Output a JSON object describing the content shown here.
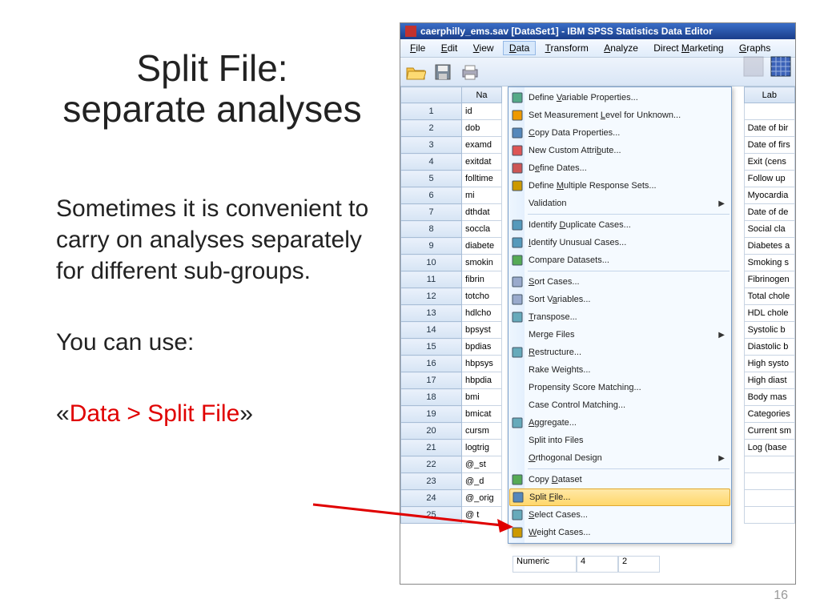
{
  "slide": {
    "title_line1": "Split File:",
    "title_line2": "separate analyses",
    "body1": "Sometimes it is convenient to carry on analyses separately for different sub-groups.",
    "body2_pre": "You can use:",
    "body3_open": "«",
    "body3_red": "Data > Split File",
    "body3_close": "»",
    "page_number": "16"
  },
  "spss": {
    "title": "caerphilly_ems.sav [DataSet1] - IBM SPSS Statistics Data Editor",
    "menubar": {
      "file": "File",
      "edit": "Edit",
      "view": "View",
      "data": "Data",
      "transform": "Transform",
      "analyze": "Analyze",
      "direct_marketing": "Direct Marketing",
      "graphs": "Graphs"
    },
    "grid": {
      "name_header": "Na",
      "label_header": "Lab",
      "rows": [
        {
          "n": "1",
          "name": "id",
          "label": ""
        },
        {
          "n": "2",
          "name": "dob",
          "label": "Date of bir"
        },
        {
          "n": "3",
          "name": "examd",
          "label": "Date of firs"
        },
        {
          "n": "4",
          "name": "exitdat",
          "label": "Exit (cens"
        },
        {
          "n": "5",
          "name": "folltime",
          "label": "Follow up"
        },
        {
          "n": "6",
          "name": "mi",
          "label": "Myocardia"
        },
        {
          "n": "7",
          "name": "dthdat",
          "label": "Date of de"
        },
        {
          "n": "8",
          "name": "soccla",
          "label": "Social cla"
        },
        {
          "n": "9",
          "name": "diabete",
          "label": "Diabetes a"
        },
        {
          "n": "10",
          "name": "smokin",
          "label": "Smoking s"
        },
        {
          "n": "11",
          "name": "fibrin",
          "label": "Fibrinogen"
        },
        {
          "n": "12",
          "name": "totcho",
          "label": "Total chole"
        },
        {
          "n": "13",
          "name": "hdlcho",
          "label": "HDL chole"
        },
        {
          "n": "14",
          "name": "bpsyst",
          "label": "Systolic b"
        },
        {
          "n": "15",
          "name": "bpdias",
          "label": "Diastolic b"
        },
        {
          "n": "16",
          "name": "hbpsys",
          "label": "High systo"
        },
        {
          "n": "17",
          "name": "hbpdia",
          "label": "High diast"
        },
        {
          "n": "18",
          "name": "bmi",
          "label": "Body mas"
        },
        {
          "n": "19",
          "name": "bmicat",
          "label": "Categories"
        },
        {
          "n": "20",
          "name": "cursm",
          "label": "Current sm"
        },
        {
          "n": "21",
          "name": "logtrig",
          "label": "Log (base"
        },
        {
          "n": "22",
          "name": "@_st",
          "label": ""
        },
        {
          "n": "23",
          "name": "@_d",
          "label": ""
        },
        {
          "n": "24",
          "name": "@_orig",
          "label": ""
        },
        {
          "n": "25",
          "name": "@ t",
          "label": ""
        }
      ],
      "extra_cells": {
        "c1": "Numeric",
        "c2": "4",
        "c3": "2"
      }
    },
    "menu": {
      "items": [
        {
          "label": "Define Variable Properties...",
          "icon": "props",
          "u": "V"
        },
        {
          "label": "Set Measurement Level for Unknown...",
          "icon": "question",
          "u": "L"
        },
        {
          "label": "Copy Data Properties...",
          "icon": "copy",
          "u": "C"
        },
        {
          "label": "New Custom Attribute...",
          "icon": "new",
          "u": "b"
        },
        {
          "label": "Define Dates...",
          "icon": "dates",
          "u": "e"
        },
        {
          "label": "Define Multiple Response Sets...",
          "icon": "mr",
          "u": "M"
        },
        {
          "label": "Validation",
          "icon": "",
          "sub": true,
          "sep_after": true
        },
        {
          "label": "Identify Duplicate Cases...",
          "icon": "dup",
          "u": "D"
        },
        {
          "label": "Identify Unusual Cases...",
          "icon": "unusual",
          "u": "I"
        },
        {
          "label": "Compare Datasets...",
          "icon": "compare",
          "sep_after": true
        },
        {
          "label": "Sort Cases...",
          "icon": "sort",
          "u": "S"
        },
        {
          "label": "Sort Variables...",
          "icon": "sortv",
          "u": "a"
        },
        {
          "label": "Transpose...",
          "icon": "trans",
          "u": "T"
        },
        {
          "label": "Merge Files",
          "icon": "",
          "sub": true
        },
        {
          "label": "Restructure...",
          "icon": "restruct",
          "u": "R"
        },
        {
          "label": "Rake Weights...",
          "icon": ""
        },
        {
          "label": "Propensity Score Matching...",
          "icon": ""
        },
        {
          "label": "Case Control Matching...",
          "icon": ""
        },
        {
          "label": "Aggregate...",
          "icon": "agg",
          "u": "A"
        },
        {
          "label": "Split into Files",
          "icon": ""
        },
        {
          "label": "Orthogonal Design",
          "icon": "",
          "u": "O",
          "sub": true,
          "sep_after": true
        },
        {
          "label": "Copy Dataset",
          "icon": "copyd",
          "u": "D"
        },
        {
          "label": "Split File...",
          "icon": "split",
          "u": "F",
          "highlighted": true
        },
        {
          "label": "Select Cases...",
          "icon": "select",
          "u": "S"
        },
        {
          "label": "Weight Cases...",
          "icon": "weight",
          "u": "W"
        }
      ]
    }
  }
}
